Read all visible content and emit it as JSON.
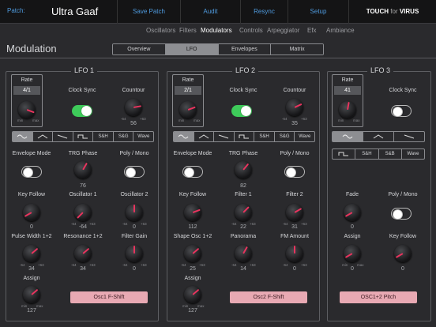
{
  "header": {
    "patch_label": "Patch:",
    "patch_name": "Ultra Gaaf",
    "save": "Save Patch",
    "audit": "Audit",
    "resync": "Resync",
    "setup": "Setup",
    "brand_touch": "TOUCH",
    "brand_for": "for",
    "brand_virus": "VIRUS"
  },
  "nav": {
    "tabs": [
      "Oscillators",
      "Filters",
      "Modulators",
      "Controls",
      "Arpeggiator",
      "Efx",
      "Ambiance"
    ],
    "active": "Modulators"
  },
  "page": {
    "title": "Modulation",
    "segments": [
      "Overview",
      "LFO",
      "Envelopes",
      "Matrix"
    ],
    "active_segment": "LFO"
  },
  "labels": {
    "rate": "Rate",
    "clock_sync": "Clock Sync",
    "contour": "Countour",
    "envelope_mode": "Envelope Mode",
    "trg_phase": "TRG Phase",
    "poly_mono": "Poly / Mono",
    "key_follow": "Key Follow",
    "assign": "Assign",
    "fade": "Fade",
    "min": "min",
    "max": "max",
    "m64": "-64",
    "p63": "+63",
    "sh": "S&H",
    "sg": "S&G",
    "sb": "S&B",
    "wave": "Wave"
  },
  "lfo1": {
    "title": "LFO 1",
    "rate": "4/1",
    "contour": "56",
    "trg_phase": "76",
    "osc1_label": "Oscillator 1",
    "osc1": "-64",
    "osc2_label": "Oscillator 2",
    "osc2": "0",
    "k1_label": "Pulse Width 1+2",
    "k1": "34",
    "k2_label": "Resonance 1+2",
    "k2": "34",
    "k3_label": "Filter Gain",
    "k3": "0",
    "key_follow": "0",
    "assign": "127",
    "assign_target": "Osc1 F-Shift",
    "clock_sync": true,
    "env_mode": false,
    "poly": false
  },
  "lfo2": {
    "title": "LFO 2",
    "rate": "2/1",
    "contour": "35",
    "trg_phase": "82",
    "a_label": "Filter 1",
    "a": "22",
    "b_label": "Filter 2",
    "b": "31",
    "c_label": "Shape Osc 1+2",
    "c": "25",
    "d_label": "Panorama",
    "d": "14",
    "e_label": "FM Amount",
    "e": "0",
    "key_follow": "112",
    "assign": "127",
    "assign_target": "Osc2 F-Shift",
    "clock_sync": true,
    "env_mode": false,
    "poly": false
  },
  "lfo3": {
    "title": "LFO 3",
    "rate": "41",
    "fade": "0",
    "assign": "0",
    "key_follow": "0",
    "assign_target": "OSC1+2 Pitch",
    "clock_sync": false,
    "poly": false
  },
  "colors": {
    "accent": "#4f9bdf",
    "knob_indicator": "#e8345e",
    "toggle_on": "#3ecb5a",
    "assign_bg": "#e8a9b3"
  }
}
